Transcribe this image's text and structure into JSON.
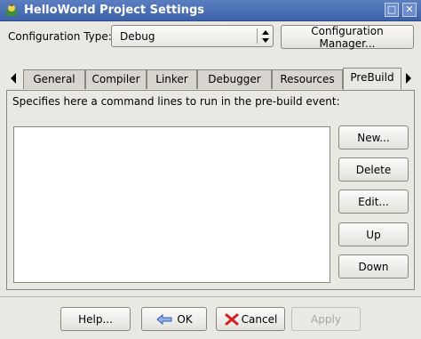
{
  "window": {
    "title": "HelloWorld Project Settings",
    "controls": {
      "maximize_icon": "maximize-icon",
      "close_icon": "close-icon"
    }
  },
  "config": {
    "label": "Configuration Type:",
    "selected": "Debug",
    "manager_button": "Configuration Manager..."
  },
  "tabs": [
    {
      "label": "General"
    },
    {
      "label": "Compiler"
    },
    {
      "label": "Linker"
    },
    {
      "label": "Debugger"
    },
    {
      "label": "Resources"
    },
    {
      "label": "PreBuild",
      "active": true
    }
  ],
  "prebuild": {
    "description": "Specifies here a command lines to run in the pre-build event:",
    "commands": [],
    "buttons": {
      "new": "New...",
      "delete": "Delete",
      "edit": "Edit...",
      "up": "Up",
      "down": "Down"
    }
  },
  "footer": {
    "help": "Help...",
    "ok": "OK",
    "cancel": "Cancel",
    "apply": "Apply",
    "apply_enabled": false
  },
  "colors": {
    "titlebar": "#4a6fb5",
    "dialog_bg": "#eae8e3",
    "cancel_icon": "#d42020",
    "ok_icon": "#3a62b0"
  }
}
